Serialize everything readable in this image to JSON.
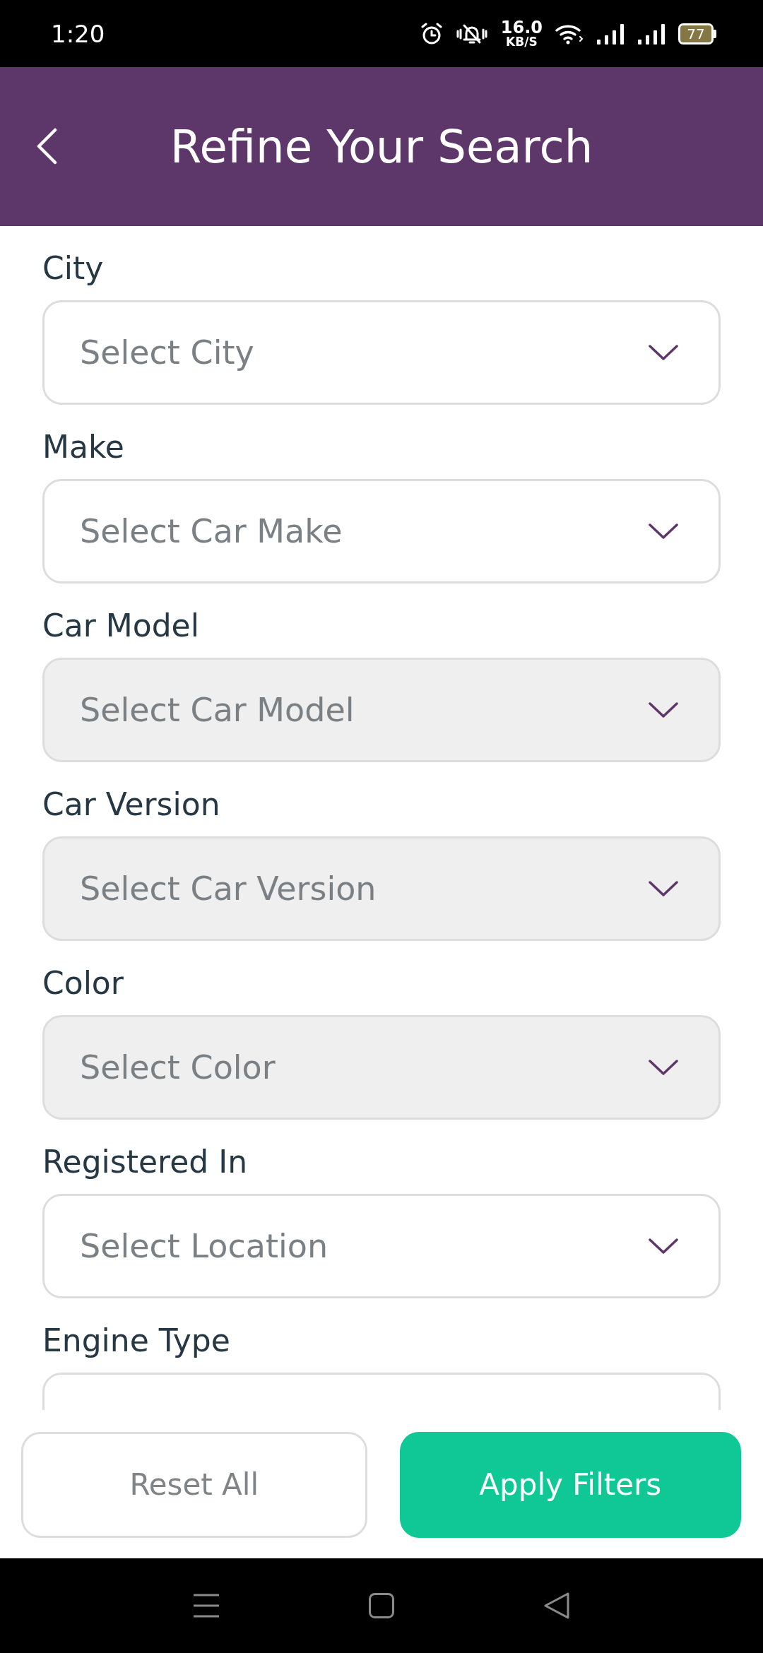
{
  "status_bar": {
    "time": "1:20",
    "network_speed": "16.0",
    "network_speed_unit": "KB/S",
    "battery": "77"
  },
  "header": {
    "title": "Refine Your Search"
  },
  "filters": [
    {
      "label": "City",
      "placeholder": "Select City",
      "disabled": false
    },
    {
      "label": "Make",
      "placeholder": "Select Car Make",
      "disabled": false
    },
    {
      "label": "Car Model",
      "placeholder": "Select Car Model",
      "disabled": true
    },
    {
      "label": "Car Version",
      "placeholder": "Select Car Version",
      "disabled": true
    },
    {
      "label": "Color",
      "placeholder": "Select Color",
      "disabled": true
    },
    {
      "label": "Registered In",
      "placeholder": "Select Location",
      "disabled": false
    },
    {
      "label": "Engine Type",
      "disabled": false
    }
  ],
  "buttons": [
    {
      "label": "Reset All",
      "kind": "secondary"
    },
    {
      "label": "Apply Filters",
      "kind": "primary"
    }
  ]
}
